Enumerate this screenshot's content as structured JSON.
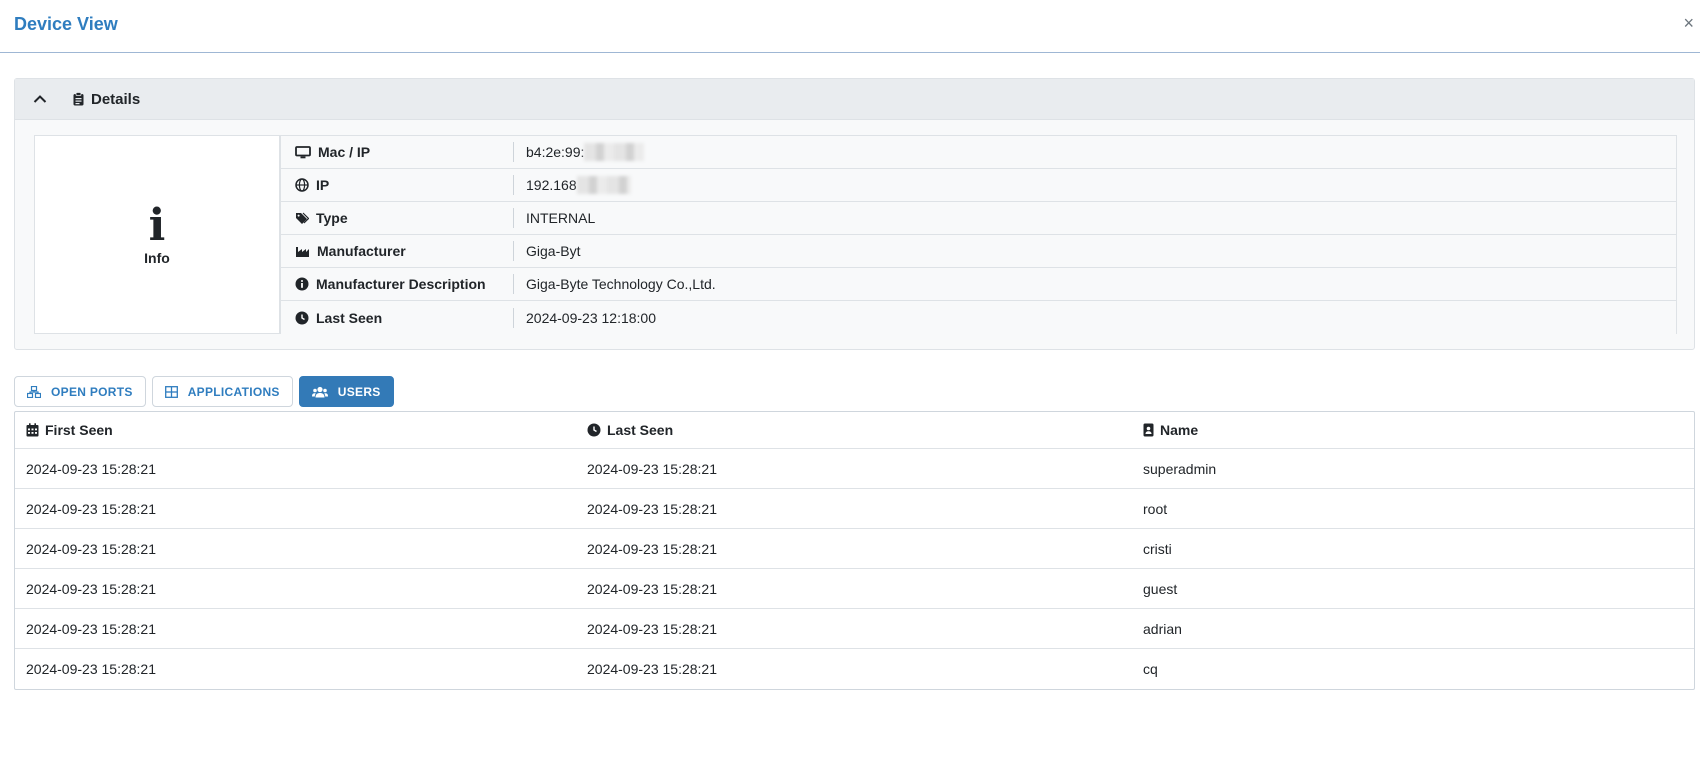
{
  "modal": {
    "title": "Device View",
    "close": "×"
  },
  "details": {
    "title": "Details",
    "info_label": "Info",
    "info_glyph": "i",
    "rows": [
      {
        "label": "Mac / IP",
        "icon": "monitor-icon",
        "value": "b4:2e:99:"
      },
      {
        "label": "IP",
        "icon": "globe-icon",
        "value": "192.168"
      },
      {
        "label": "Type",
        "icon": "tags-icon",
        "value": "INTERNAL"
      },
      {
        "label": "Manufacturer",
        "icon": "industry-icon",
        "value": "Giga-Byt"
      },
      {
        "label": "Manufacturer Description",
        "icon": "info-circle-icon",
        "value": "Giga-Byte Technology Co.,Ltd."
      },
      {
        "label": "Last Seen",
        "icon": "clock-icon",
        "value": "2024-09-23 12:18:00"
      }
    ]
  },
  "tabs": [
    {
      "label": "OPEN PORTS",
      "icon": "network-icon",
      "active": false
    },
    {
      "label": "APPLICATIONS",
      "icon": "grid-icon",
      "active": false
    },
    {
      "label": "USERS",
      "icon": "users-icon",
      "active": true
    }
  ],
  "users_table": {
    "headers": [
      "First Seen",
      "Last Seen",
      "Name"
    ],
    "rows": [
      [
        "2024-09-23 15:28:21",
        "2024-09-23 15:28:21",
        "superadmin"
      ],
      [
        "2024-09-23 15:28:21",
        "2024-09-23 15:28:21",
        "root"
      ],
      [
        "2024-09-23 15:28:21",
        "2024-09-23 15:28:21",
        "cristi"
      ],
      [
        "2024-09-23 15:28:21",
        "2024-09-23 15:28:21",
        "guest"
      ],
      [
        "2024-09-23 15:28:21",
        "2024-09-23 15:28:21",
        "adrian"
      ],
      [
        "2024-09-23 15:28:21",
        "2024-09-23 15:28:21",
        "cq"
      ]
    ]
  },
  "colors": {
    "accent": "#2f7dbf",
    "active_tab": "#337ab7"
  }
}
